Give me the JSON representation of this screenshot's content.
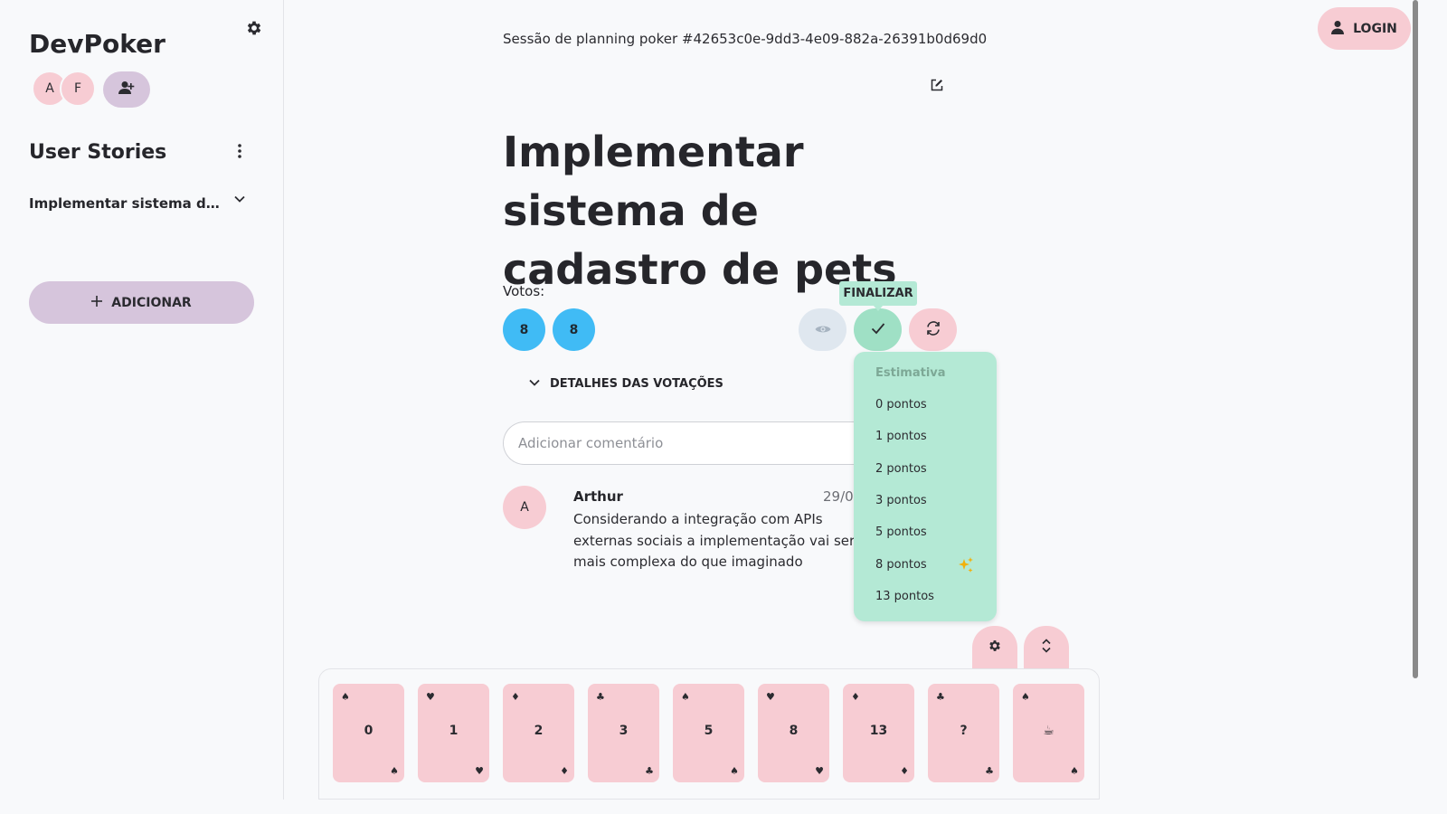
{
  "app": {
    "title": "DevPoker"
  },
  "sidebar": {
    "avatars": [
      "A",
      "F"
    ],
    "section_title": "User Stories",
    "stories": [
      {
        "label": "Implementar sistema de ca..."
      }
    ],
    "add_label": "ADICIONAR"
  },
  "header": {
    "session": "Sessão de planning poker #42653c0e-9dd3-4e09-882a-26391b0d69d0",
    "login_label": "LOGIN"
  },
  "story": {
    "title": "Implementar sistema de cadastro de pets"
  },
  "votes": {
    "label": "Votos:",
    "values": [
      "8",
      "8"
    ],
    "finalize_tooltip": "FINALIZAR",
    "details_label": "DETALHES DAS VOTAÇÕES"
  },
  "estimate_menu": {
    "header": "Estimativa",
    "options": [
      "0 pontos",
      "1 pontos",
      "2 pontos",
      "3 pontos",
      "5 pontos",
      "8 pontos",
      "13 pontos"
    ],
    "suggested": "8 pontos"
  },
  "comments": {
    "placeholder": "Adicionar comentário",
    "items": [
      {
        "avatar": "A",
        "author": "Arthur",
        "date": "29/0",
        "text": "Considerando a integração com APIs externas sociais a implementação vai ser mais complexa do que imaginado"
      }
    ]
  },
  "deck": {
    "cards": [
      {
        "value": "0",
        "suit": "♠"
      },
      {
        "value": "1",
        "suit": "♥"
      },
      {
        "value": "2",
        "suit": "♦"
      },
      {
        "value": "3",
        "suit": "♣"
      },
      {
        "value": "5",
        "suit": "♠"
      },
      {
        "value": "8",
        "suit": "♥"
      },
      {
        "value": "13",
        "suit": "♦"
      },
      {
        "value": "?",
        "suit": "♣"
      },
      {
        "value": "☕",
        "suit": "♠"
      }
    ]
  },
  "colors": {
    "vote": "#40bbf5",
    "pink": "#f7ccd3",
    "lilac": "#d6c5dc",
    "mint": "#b4e9d5",
    "reveal": "#dfe7ef"
  }
}
